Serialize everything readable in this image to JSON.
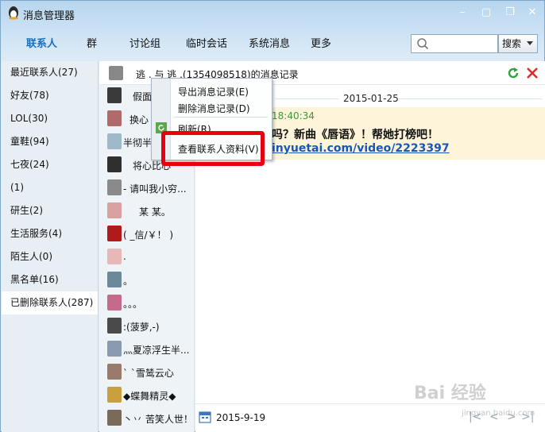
{
  "window": {
    "title": "消息管理器"
  },
  "tabs": [
    "联系人",
    "群",
    "讨论组",
    "临时会话",
    "系统消息",
    "更多"
  ],
  "search": {
    "placeholder": "",
    "button_label": "搜索"
  },
  "groups": [
    "最近联系人(27)",
    "好友(78)",
    "LOL(30)",
    "童鞋(94)",
    "七夜(24)",
    "(1)",
    "研生(2)",
    "生活服务(4)",
    "陌生人(0)",
    "黑名单(16)",
    "已删除联系人(287)"
  ],
  "contacts": [
    "",
    "假面",
    "换心",
    "半彻半",
    "将心比心",
    "- 请叫我小穷...",
    "某 某。",
    "( _信/￥！ )",
    ".",
    "。",
    "。。。",
    ":(菠萝,-)",
    "灬夏凉浮生半...",
    "` `雪鸶云心",
    "◆蝶舞精灵◆",
    "丶丷 苦笑人世！"
  ],
  "header": {
    "text": "逃 .  与 逃 .(1354098518)的消息记录"
  },
  "chat": {
    "date": "2015-01-25",
    "time": "18:40:34",
    "line1": "吗？新曲《唇语》！帮她打榜吧！",
    "line2": "inyuetai.com/video/2223397"
  },
  "context_menu": {
    "export": "导出消息记录(E)",
    "delete": "删除消息记录(D)",
    "refresh": "刷新(R)",
    "view_profile": "查看联系人资料(V)"
  },
  "footer": {
    "date": "2015-9-19"
  },
  "watermark": {
    "main": "Bai 经验",
    "sub": "jingyan.baidu.com"
  },
  "colors": {
    "accent": "#1a6fc2",
    "highlight": "#e60012",
    "message_bg": "#fdf4d9"
  }
}
